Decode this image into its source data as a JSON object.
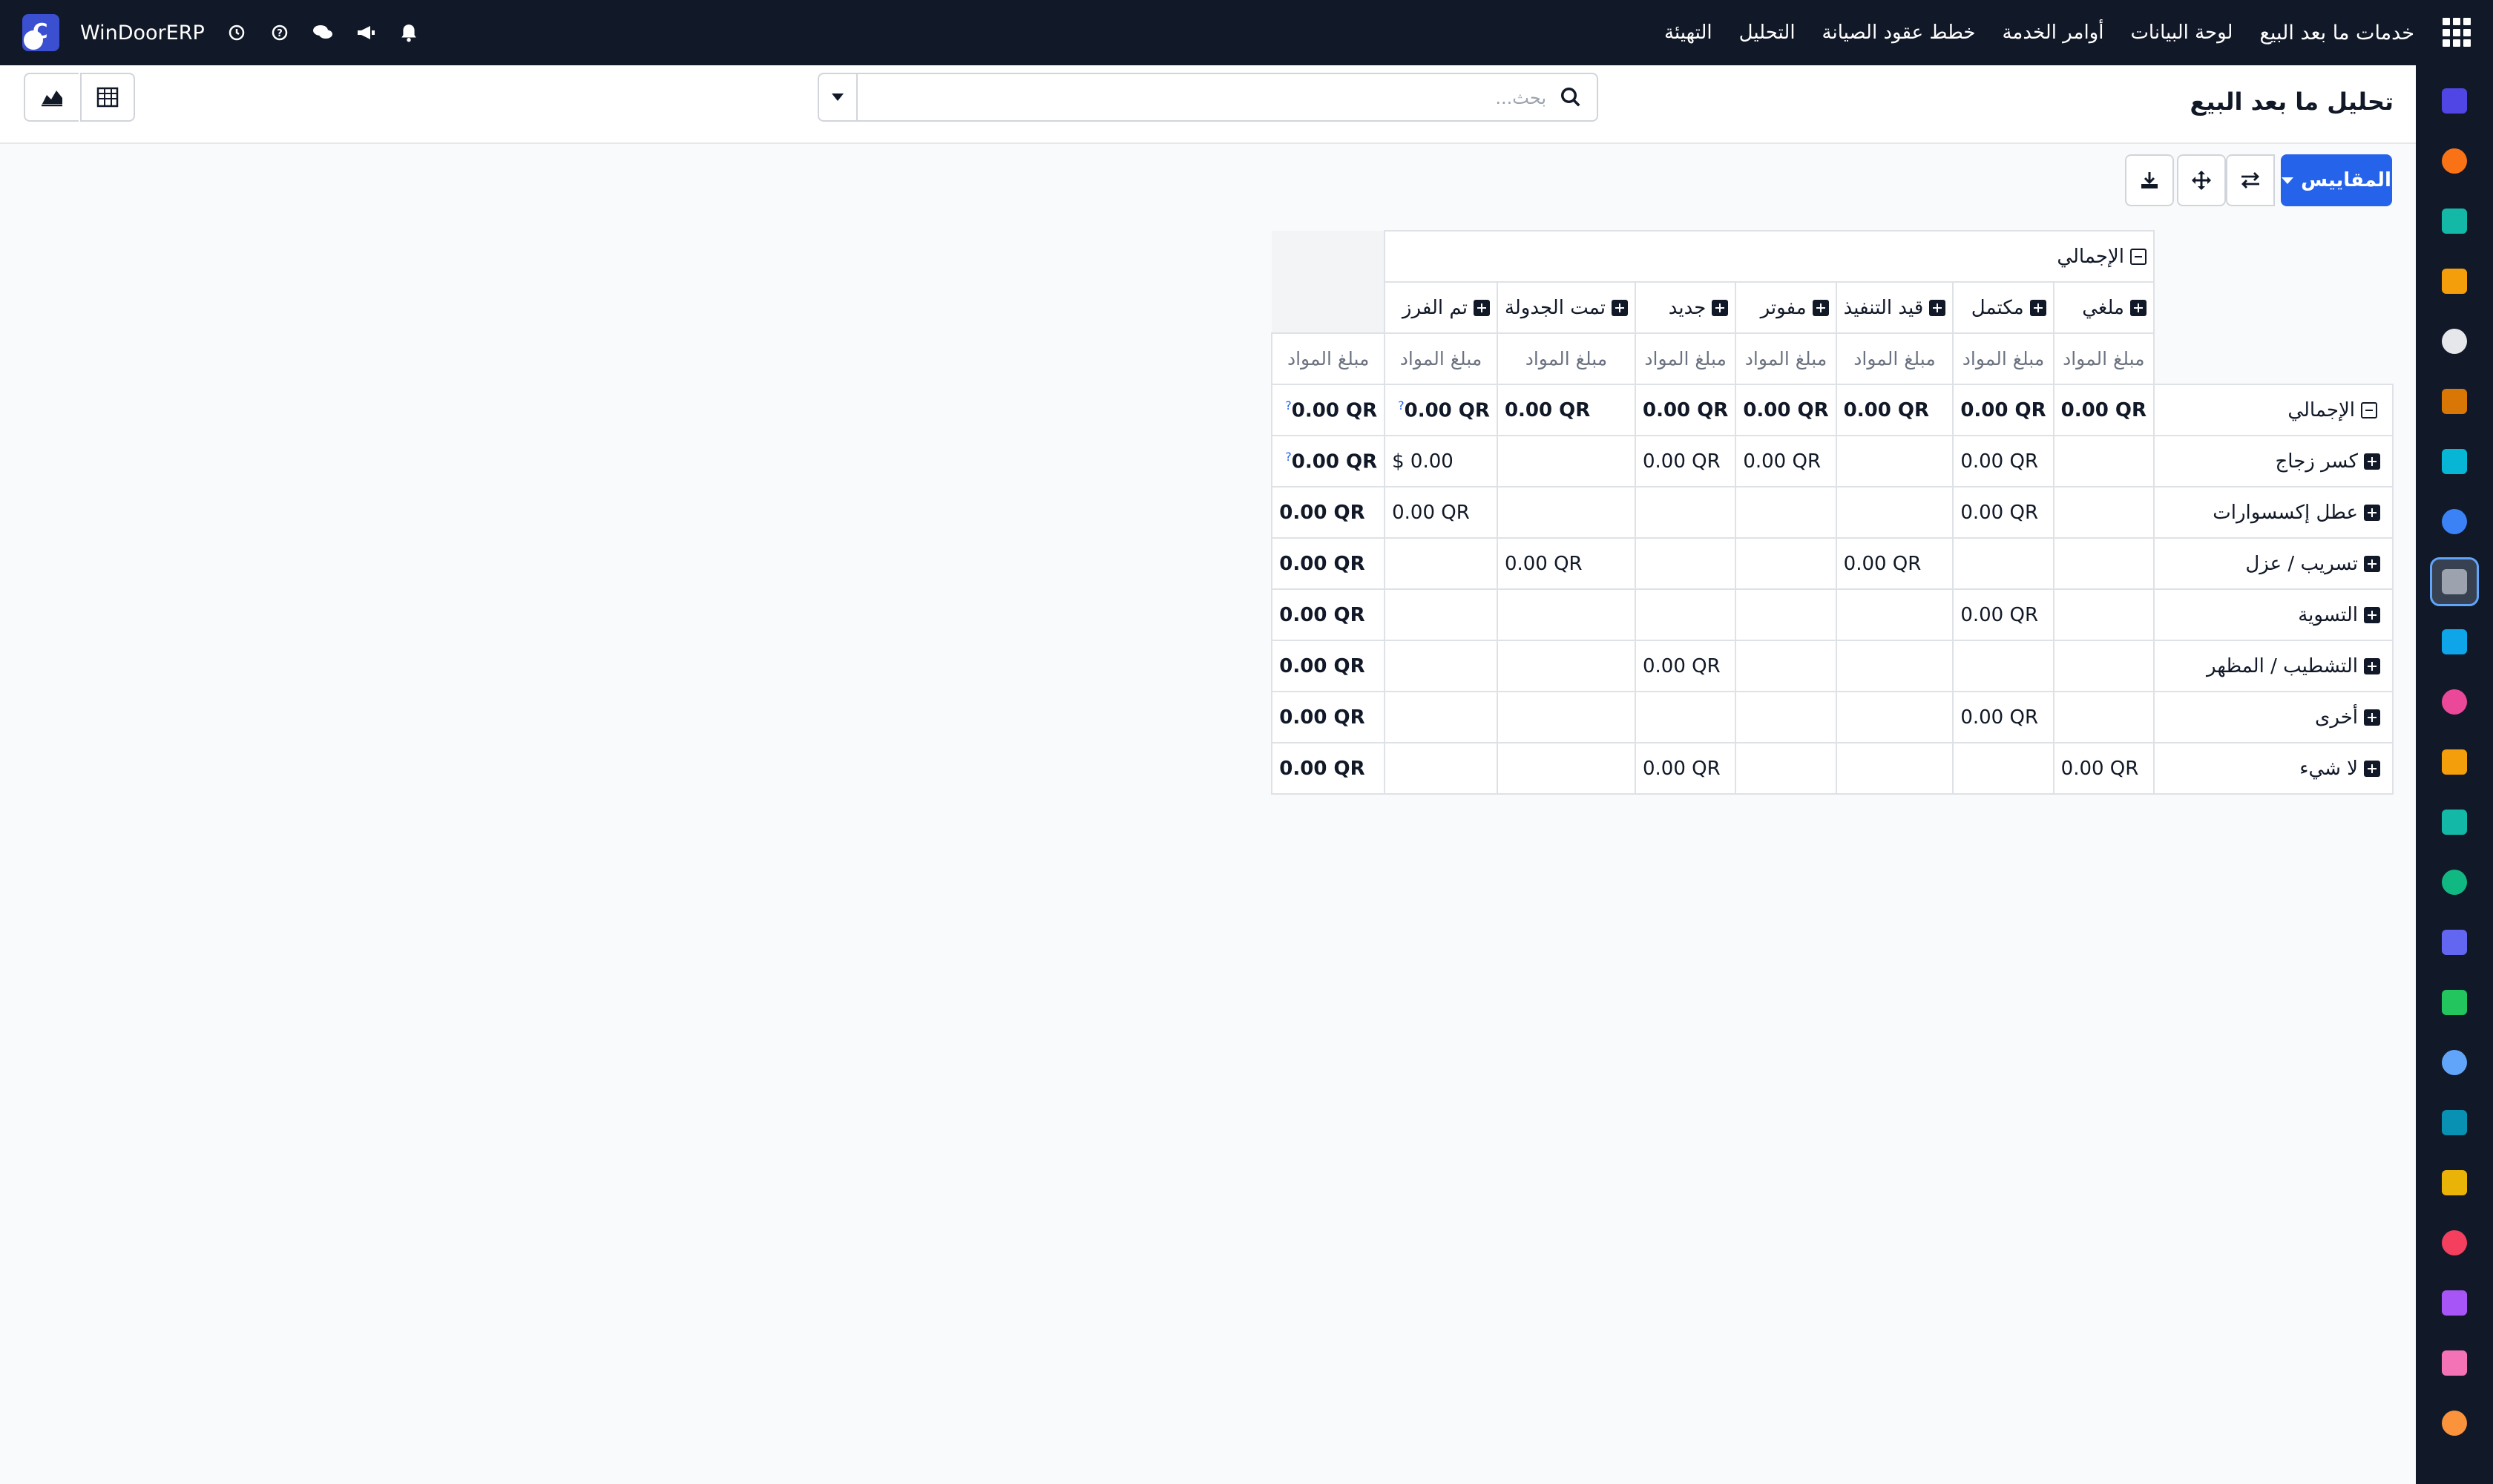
{
  "navbar": {
    "menu": [
      "خدمات ما بعد البيع",
      "لوحة البيانات",
      "أوامر الخدمة",
      "خطط عقود الصيانة",
      "التحليل",
      "التهيئة"
    ],
    "company_name": "WinDoorERP",
    "company_logo_letter": "C"
  },
  "page": {
    "title": "تحليل ما بعد البيع"
  },
  "search": {
    "placeholder": "بحث...",
    "value": ""
  },
  "toolbar": {
    "measures_label": "المقاييس"
  },
  "pivot": {
    "total_label": "الإجمالي",
    "measure_label": "مبلغ المواد",
    "columns": [
      "ملغي",
      "مكتمل",
      "قيد التنفيذ",
      "مفوتر",
      "جديد",
      "تمت الجدولة",
      "تم الفرز"
    ],
    "rows": [
      {
        "label": "الإجمالي",
        "values": [
          "0.00 QR",
          "0.00 QR",
          "0.00 QR",
          "0.00 QR",
          "0.00 QR",
          "0.00 QR",
          "0.00 QR"
        ],
        "total": "0.00 QR"
      },
      {
        "label": "كسر زجاج",
        "values": [
          "",
          "0.00 QR",
          "",
          "0.00 QR",
          "0.00 QR",
          "",
          "$ 0.00"
        ],
        "total": "0.00 QR"
      },
      {
        "label": "عطل إكسسوارات",
        "values": [
          "",
          "0.00 QR",
          "",
          "",
          "",
          "",
          "0.00 QR"
        ],
        "total": "0.00 QR"
      },
      {
        "label": "تسريب / عزل",
        "values": [
          "",
          "",
          "0.00 QR",
          "",
          "",
          "0.00 QR",
          ""
        ],
        "total": "0.00 QR"
      },
      {
        "label": "التسوية",
        "values": [
          "",
          "0.00 QR",
          "",
          "",
          "",
          "",
          ""
        ],
        "total": "0.00 QR"
      },
      {
        "label": "التشطيب / المظهر",
        "values": [
          "",
          "",
          "",
          "",
          "0.00 QR",
          "",
          ""
        ],
        "total": "0.00 QR"
      },
      {
        "label": "أخرى",
        "values": [
          "",
          "0.00 QR",
          "",
          "",
          "",
          "",
          ""
        ],
        "total": "0.00 QR"
      },
      {
        "label": "لا شيء",
        "values": [
          "0.00 QR",
          "",
          "",
          "",
          "0.00 QR",
          "",
          ""
        ],
        "total": "0.00 QR"
      }
    ],
    "help_mark": "?"
  },
  "sidebar_apps": [
    {
      "icon": "mail-app-icon",
      "color": "#4f46e5"
    },
    {
      "icon": "chat-app-icon",
      "color": "#f97316"
    },
    {
      "icon": "inventory-app-icon",
      "color": "#14b8a6"
    },
    {
      "icon": "reports-app-icon",
      "color": "#f59e0b"
    },
    {
      "icon": "product-app-icon",
      "color": "#e5e7eb"
    },
    {
      "icon": "contacts-app-icon",
      "color": "#d97706"
    },
    {
      "icon": "tasks-app-icon",
      "color": "#06b6d4"
    },
    {
      "icon": "knowledge-app-icon",
      "color": "#3b82f6"
    },
    {
      "icon": "aftersales-app-icon",
      "color": "#9ca3af"
    },
    {
      "icon": "invoicing-app-icon",
      "color": "#0ea5e9"
    },
    {
      "icon": "employees-app-icon",
      "color": "#ec4899"
    },
    {
      "icon": "calendar-app-icon",
      "color": "#f59e0b"
    },
    {
      "icon": "sign-app-icon",
      "color": "#14b8a6"
    },
    {
      "icon": "contacts-book-app-icon",
      "color": "#10b981"
    },
    {
      "icon": "dashboards-app-icon",
      "color": "#6366f1"
    },
    {
      "icon": "whatsapp-app-icon",
      "color": "#22c55e"
    },
    {
      "icon": "time-app-icon",
      "color": "#60a5fa"
    },
    {
      "icon": "discuss-app-icon",
      "color": "#0891b2"
    },
    {
      "icon": "email-marketing-app-icon",
      "color": "#eab308"
    },
    {
      "icon": "events-app-icon",
      "color": "#f43f5e"
    },
    {
      "icon": "manufacturing-app-icon",
      "color": "#a855f7"
    },
    {
      "icon": "pos-app-icon",
      "color": "#f472b6"
    },
    {
      "icon": "odoo-app-icon",
      "color": "#fb923c"
    }
  ]
}
